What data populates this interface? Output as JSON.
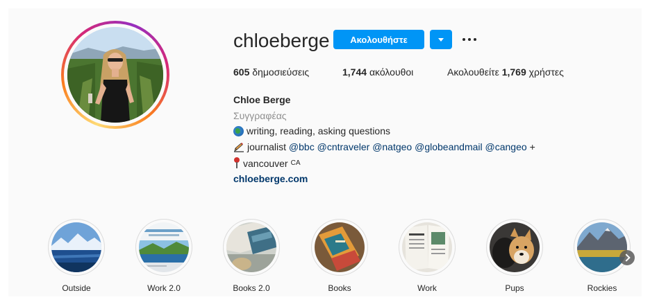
{
  "profile": {
    "username": "chloeberge",
    "follow_label": "Ακολουθήστε",
    "posts_count": "605",
    "posts_label": "δημοσιεύσεις",
    "followers_count": "1,744",
    "followers_label": "ακόλουθοι",
    "following_prefix": "Ακολουθείτε",
    "following_count": "1,769",
    "following_suffix": "χρήστες"
  },
  "bio": {
    "name": "Chloe Berge",
    "category": "Συγγραφέας",
    "line1": "writing, reading, asking questions",
    "line2_prefix": "journalist",
    "mentions": [
      "@bbc",
      "@cntraveler",
      "@natgeo",
      "@globeandmail",
      "@cangeo"
    ],
    "line2_suffix": "+",
    "location": "vancouver",
    "location_flag": "CA",
    "link": "chloeberge.com"
  },
  "highlights": [
    {
      "label": "Outside"
    },
    {
      "label": "Work 2.0"
    },
    {
      "label": "Books 2.0"
    },
    {
      "label": "Books"
    },
    {
      "label": "Work"
    },
    {
      "label": "Pups"
    },
    {
      "label": "Rockies"
    }
  ],
  "icons": {
    "follow_dropdown": "chevron-down-icon",
    "more": "more-options-icon",
    "bio_line1": "globe-icon",
    "bio_line2": "pen-writing-icon",
    "bio_location": "pin-icon",
    "carousel_next": "chevron-right-icon"
  },
  "colors": {
    "accent": "#0095f6",
    "link": "#00376b",
    "secondary_text": "#8e8e8e"
  }
}
